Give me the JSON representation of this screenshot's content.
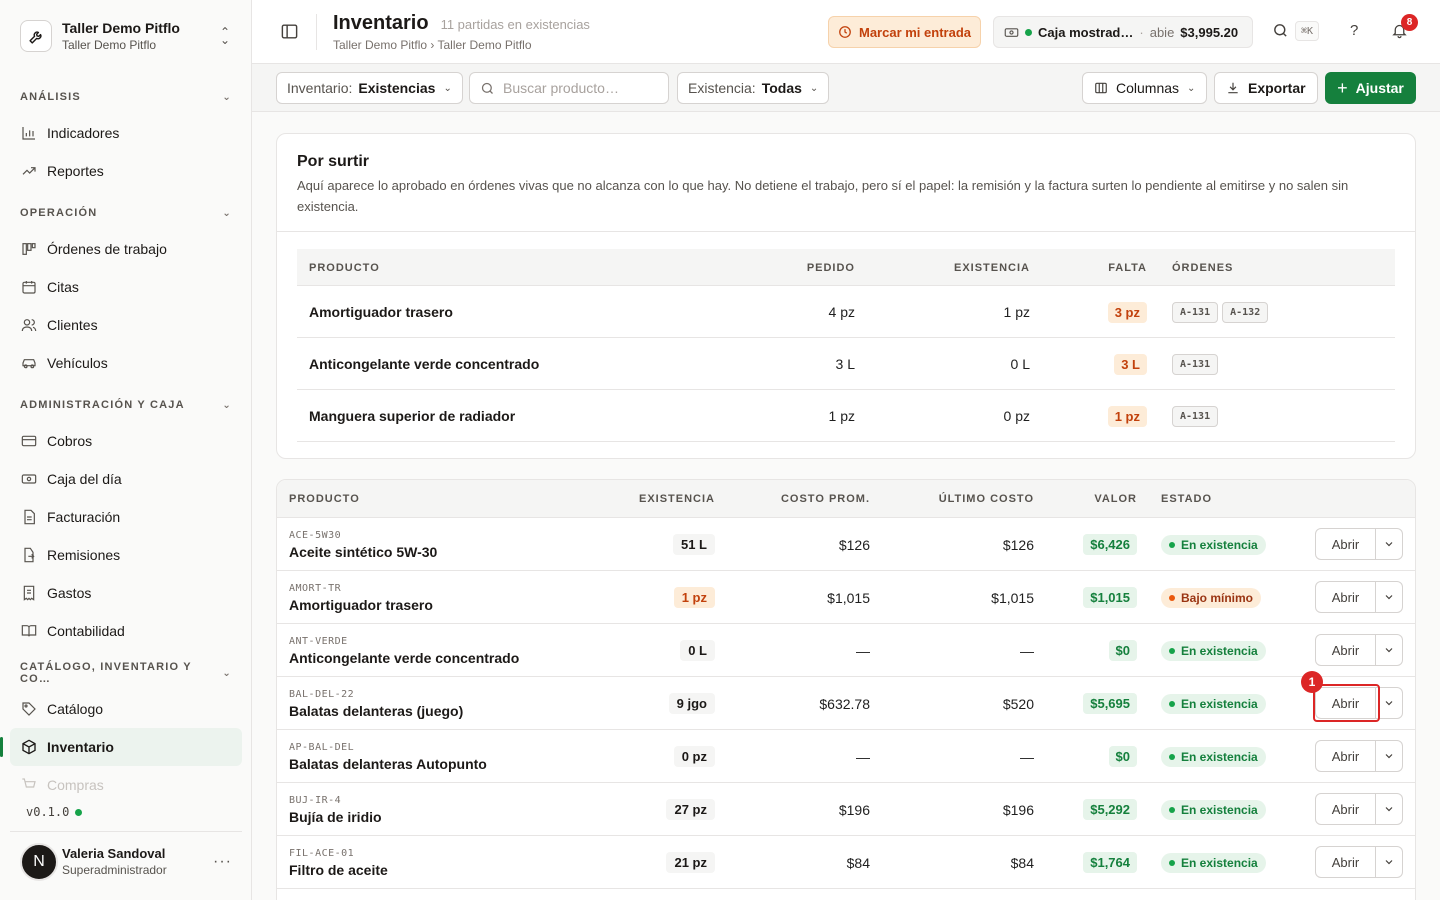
{
  "sidebar": {
    "org_name": "Taller Demo Pitflo",
    "org_sub": "Taller Demo Pitflo",
    "sections": [
      {
        "label": "ANÁLISIS"
      },
      {
        "label": "OPERACIÓN"
      },
      {
        "label": "ADMINISTRACIÓN Y CAJA"
      },
      {
        "label": "CATÁLOGO, INVENTARIO Y CO…"
      }
    ],
    "items": {
      "indicadores": "Indicadores",
      "reportes": "Reportes",
      "ordenes": "Órdenes de trabajo",
      "citas": "Citas",
      "clientes": "Clientes",
      "vehiculos": "Vehículos",
      "cobros": "Cobros",
      "caja": "Caja del día",
      "facturacion": "Facturación",
      "remisiones": "Remisiones",
      "gastos": "Gastos",
      "contabilidad": "Contabilidad",
      "catalogo": "Catálogo",
      "inventario": "Inventario",
      "compras": "Compras"
    },
    "version": "v0.1.0",
    "user": {
      "initial": "N",
      "name": "Valeria Sandoval",
      "role": "Superadministrador"
    }
  },
  "header": {
    "title": "Inventario",
    "subtitle": "11 partidas en existencias",
    "breadcrumb": "Taller Demo Pitflo › Taller Demo Pitflo",
    "entry_button": "Marcar mi entrada",
    "caja": {
      "name": "Caja mostrad…",
      "sep": "·",
      "state": "abie",
      "amount": "$3,995.20"
    },
    "shortcut": "⌘K",
    "help": "?",
    "notifications": "8"
  },
  "toolbar": {
    "inventory_label": "Inventario:",
    "inventory_value": "Existencias",
    "search_placeholder": "Buscar producto…",
    "stock_label": "Existencia:",
    "stock_value": "Todas",
    "columns": "Columnas",
    "export": "Exportar",
    "adjust": "Ajustar"
  },
  "restock": {
    "title": "Por surtir",
    "description": "Aquí aparece lo aprobado en órdenes vivas que no alcanza con lo que hay. No detiene el trabajo, pero sí el papel: la remisión y la factura surten lo pendiente al emitirse y no salen sin existencia.",
    "columns": [
      "PRODUCTO",
      "PEDIDO",
      "EXISTENCIA",
      "FALTA",
      "ÓRDENES"
    ],
    "rows": [
      {
        "product": "Amortiguador trasero",
        "ordered": "4 pz",
        "stock": "1 pz",
        "missing": "3 pz",
        "orders": [
          "A-131",
          "A-132"
        ]
      },
      {
        "product": "Anticongelante verde concentrado",
        "ordered": "3 L",
        "stock": "0 L",
        "missing": "3 L",
        "orders": [
          "A-131"
        ]
      },
      {
        "product": "Manguera superior de radiador",
        "ordered": "1 pz",
        "stock": "0 pz",
        "missing": "1 pz",
        "orders": [
          "A-131"
        ]
      }
    ]
  },
  "inventory": {
    "columns": [
      "PRODUCTO",
      "EXISTENCIA",
      "COSTO PROM.",
      "ÚLTIMO COSTO",
      "VALOR",
      "ESTADO"
    ],
    "open_label": "Abrir",
    "marker": "1",
    "rows": [
      {
        "sku": "ACE-5W30",
        "name": "Aceite sintético 5W-30",
        "stock": "51 L",
        "avg": "$126",
        "last": "$126",
        "value": "$6,426",
        "status": "En existencia"
      },
      {
        "sku": "AMORT-TR",
        "name": "Amortiguador trasero",
        "stock": "1 pz",
        "avg": "$1,015",
        "last": "$1,015",
        "value": "$1,015",
        "status": "Bajo mínimo"
      },
      {
        "sku": "ANT-VERDE",
        "name": "Anticongelante verde concentrado",
        "stock": "0 L",
        "avg": "—",
        "last": "—",
        "value": "$0",
        "status": "En existencia"
      },
      {
        "sku": "BAL-DEL-22",
        "name": "Balatas delanteras (juego)",
        "stock": "9 jgo",
        "avg": "$632.78",
        "last": "$520",
        "value": "$5,695",
        "status": "En existencia"
      },
      {
        "sku": "AP-BAL-DEL",
        "name": "Balatas delanteras Autopunto",
        "stock": "0 pz",
        "avg": "—",
        "last": "—",
        "value": "$0",
        "status": "En existencia"
      },
      {
        "sku": "BUJ-IR-4",
        "name": "Bujía de iridio",
        "stock": "27 pz",
        "avg": "$196",
        "last": "$196",
        "value": "$5,292",
        "status": "En existencia"
      },
      {
        "sku": "FIL-ACE-01",
        "name": "Filtro de aceite",
        "stock": "21 pz",
        "avg": "$84",
        "last": "$84",
        "value": "$1,764",
        "status": "En existencia"
      }
    ]
  },
  "icons": {
    "org": "wrench-icon",
    "panel": "sidebar-toggle-icon",
    "clock": "clock-icon",
    "cash": "cash-icon",
    "search": "search-icon",
    "bell": "bell-icon",
    "columns": "columns-icon",
    "download": "download-icon"
  },
  "colors": {
    "accent": "#15803d",
    "warning": "#c2410c",
    "danger": "#dc2626"
  }
}
